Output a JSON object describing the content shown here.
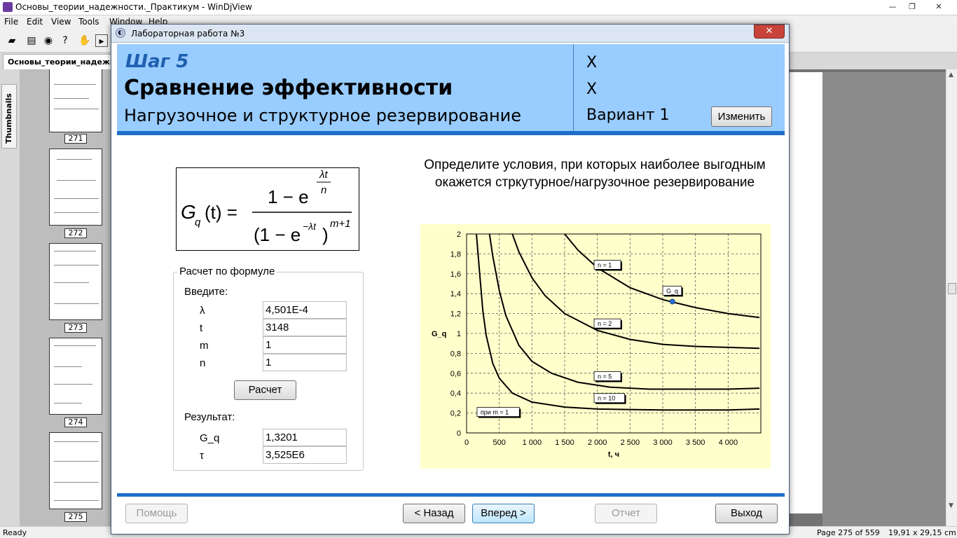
{
  "window": {
    "title": "Основы_теории_надежности._Практикум - WinDjView",
    "min": "—",
    "max": "❐",
    "close": "✕"
  },
  "menu": [
    "File",
    "Edit",
    "View",
    "Tools",
    "Window",
    "Help"
  ],
  "doc_tab": "Основы_теории_надежности",
  "side_tab": "Thumbnails",
  "thumbnails": [
    "271",
    "272",
    "273",
    "274",
    "275"
  ],
  "status": {
    "left": "Ready",
    "page": "Page 275 of 559",
    "size": "19,91 x 29,15 cm"
  },
  "dialog": {
    "title": "Лабораторная работа №3",
    "close": "✕",
    "step": "Шаг 5",
    "heading": "Сравнение эффективности",
    "subheading": "Нагрузочное и структурное резервирование",
    "x1": "X",
    "x2": "X",
    "variant": "Вариант 1",
    "change_button": "Изменить"
  },
  "formula": {
    "lhs": "G",
    "sub": "q",
    "arg": "(t) =",
    "num_lead": "1 − e",
    "num_exp_top": "λt",
    "num_exp_bottom": "n",
    "den": "(1 − e",
    "den_exp": "−λt",
    "den_close": ")",
    "den_pow": "m+1"
  },
  "calc": {
    "group_title": "Расчет по формуле",
    "input_heading": "Введите:",
    "inputs": [
      {
        "label": "λ",
        "value": "4,501E-4"
      },
      {
        "label": "t",
        "value": "3148"
      },
      {
        "label": "m",
        "value": "1"
      },
      {
        "label": "n",
        "value": "1"
      }
    ],
    "calc_button": "Расчет",
    "result_heading": "Результат:",
    "results": [
      {
        "label": "G_q",
        "value": "1,3201"
      },
      {
        "label": "τ",
        "value": "3,525E6"
      }
    ]
  },
  "question": "Определите условия, при которых наиболее выгодным окажется стркутурное/нагрузочное резервирование",
  "buttons": {
    "help": "Помощь",
    "back": "< Назад",
    "forward": "Вперед >",
    "report": "Отчет",
    "exit": "Выход"
  },
  "chart_data": {
    "type": "line",
    "xlabel": "t, ч",
    "ylabel": "G_q",
    "xlim": [
      0,
      4500
    ],
    "ylim": [
      0,
      2
    ],
    "x_ticks": [
      "0",
      "500",
      "1 000",
      "1 500",
      "2 000",
      "2 500",
      "3 000",
      "3 500",
      "4 000"
    ],
    "y_ticks": [
      "0",
      "0,2",
      "0,4",
      "0,6",
      "0,8",
      "1",
      "1,2",
      "1,4",
      "1,6",
      "1,8",
      "2"
    ],
    "grid": true,
    "series": [
      {
        "name": "n = 1",
        "x": [
          1500,
          1700,
          2000,
          2500,
          3000,
          3500,
          4000,
          4480
        ],
        "y": [
          2.0,
          1.84,
          1.66,
          1.46,
          1.34,
          1.26,
          1.2,
          1.16
        ]
      },
      {
        "name": "n = 2",
        "x": [
          700,
          800,
          1000,
          1200,
          1500,
          2000,
          2500,
          3000,
          3500,
          4000,
          4480
        ],
        "y": [
          2.0,
          1.82,
          1.56,
          1.38,
          1.2,
          1.03,
          0.94,
          0.89,
          0.87,
          0.86,
          0.85
        ]
      },
      {
        "name": "n = 5",
        "x": [
          350,
          400,
          500,
          600,
          800,
          1000,
          1300,
          1700,
          2200,
          2800,
          3500,
          4000,
          4480
        ],
        "y": [
          2.0,
          1.78,
          1.43,
          1.18,
          0.88,
          0.72,
          0.6,
          0.51,
          0.46,
          0.44,
          0.44,
          0.44,
          0.45
        ]
      },
      {
        "name": "n = 10",
        "x": [
          150,
          200,
          250,
          300,
          400,
          500,
          700,
          1000,
          1500,
          2000,
          3000,
          4000,
          4480
        ],
        "y": [
          2.0,
          1.6,
          1.22,
          0.98,
          0.7,
          0.55,
          0.4,
          0.31,
          0.26,
          0.24,
          0.23,
          0.23,
          0.24
        ]
      }
    ],
    "point": {
      "label": "G_q",
      "x": 3148,
      "y": 1.3201
    },
    "annotations": [
      "n = 1",
      "n = 2",
      "n = 5",
      "n = 10",
      "при m = 1",
      "G_q"
    ],
    "accent": "#1f6fc8"
  }
}
